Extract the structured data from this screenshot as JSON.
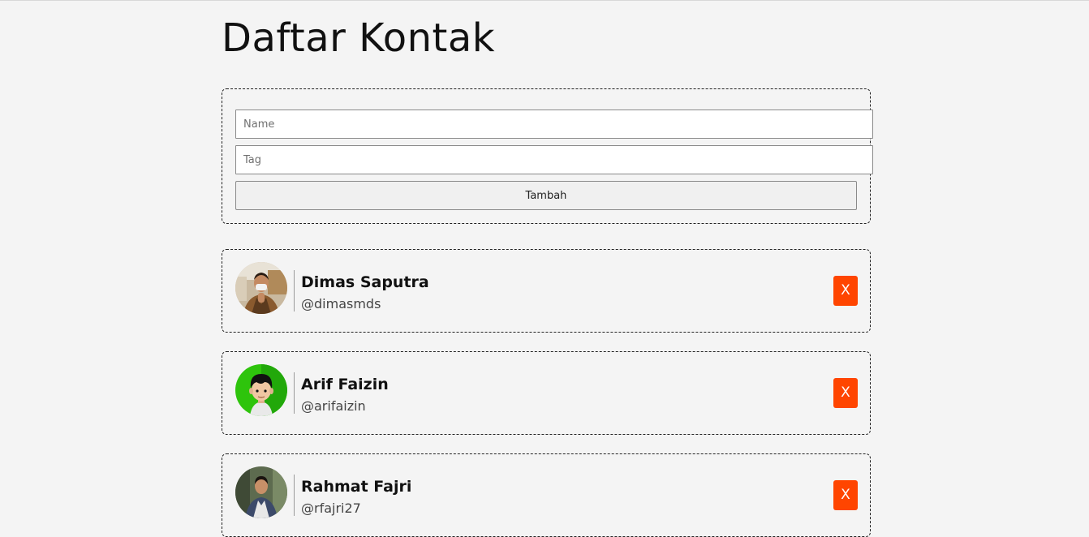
{
  "page": {
    "title": "Daftar Kontak"
  },
  "form": {
    "name_placeholder": "Name",
    "name_value": "",
    "tag_placeholder": "Tag",
    "tag_value": "",
    "submit_label": "Tambah"
  },
  "contacts": [
    {
      "name": "Dimas Saputra",
      "tag": "@dimasmds",
      "remove_label": "X",
      "avatar": "photo-avatar"
    },
    {
      "name": "Arif Faizin",
      "tag": "@arifaizin",
      "remove_label": "X",
      "avatar": "cartoon-avatar"
    },
    {
      "name": "Rahmat Fajri",
      "tag": "@rfajri27",
      "remove_label": "X",
      "avatar": "photo-avatar"
    }
  ],
  "colors": {
    "background": "#f4f4f4",
    "remove_button": "#ff4500",
    "card_border": "#222222"
  }
}
